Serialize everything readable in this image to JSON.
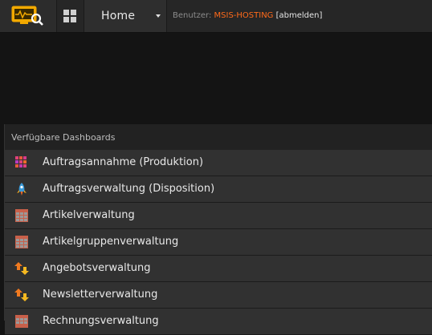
{
  "header": {
    "home_label": "Home",
    "user_prefix": "Benutzer:",
    "username": "MSIS-HOSTING",
    "logout_label": "[abmelden]"
  },
  "panel": {
    "title": "Verfügbare Dashboards"
  },
  "dashboards": [
    {
      "label": "Auftragsannahme (Produktion)",
      "icon": "color-grid-icon"
    },
    {
      "label": "Auftragsverwaltung (Disposition)",
      "icon": "rocket-icon"
    },
    {
      "label": "Artikelverwaltung",
      "icon": "table-icon"
    },
    {
      "label": "Artikelgruppenverwaltung",
      "icon": "table-icon"
    },
    {
      "label": "Angebotsverwaltung",
      "icon": "swap-arrows-icon"
    },
    {
      "label": "Newsletterverwaltung",
      "icon": "swap-arrows-icon"
    },
    {
      "label": "Rechnungsverwaltung",
      "icon": "table-icon"
    }
  ],
  "colors": {
    "accent": "#ff6a1a",
    "topbar": "#262626",
    "item_bg": "#313131"
  }
}
